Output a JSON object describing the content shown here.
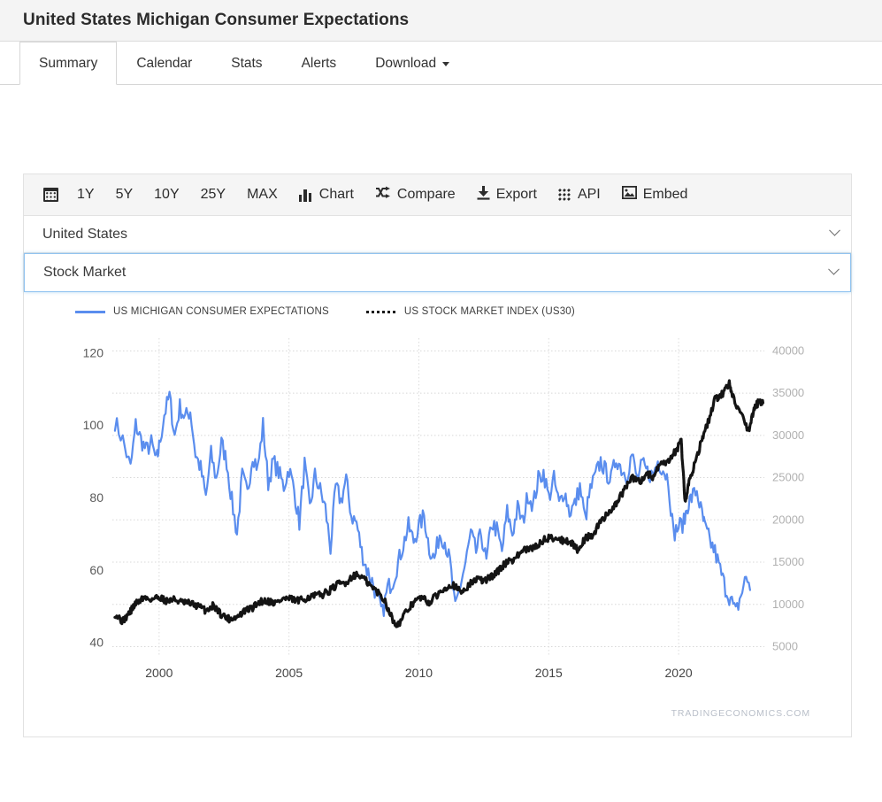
{
  "header": {
    "title": "United States Michigan Consumer Expectations"
  },
  "tabs": [
    {
      "label": "Summary",
      "active": true
    },
    {
      "label": "Calendar",
      "active": false
    },
    {
      "label": "Stats",
      "active": false
    },
    {
      "label": "Alerts",
      "active": false
    },
    {
      "label": "Download",
      "active": false,
      "has_caret": true
    }
  ],
  "toolbar": {
    "calendar_icon": "calendar-icon",
    "ranges": [
      "1Y",
      "5Y",
      "10Y",
      "25Y",
      "MAX"
    ],
    "actions": [
      {
        "label": "Chart",
        "icon": "bar-chart-icon"
      },
      {
        "label": "Compare",
        "icon": "shuffle-icon"
      },
      {
        "label": "Export",
        "icon": "download-icon"
      },
      {
        "label": "API",
        "icon": "grid-dots-icon"
      },
      {
        "label": "Embed",
        "icon": "image-icon"
      }
    ]
  },
  "selects": [
    {
      "value": "United States",
      "focused": false
    },
    {
      "value": "Stock Market",
      "focused": true
    }
  ],
  "watermark": "TRADINGECONOMICS.COM",
  "colors": {
    "series_blue": "#5a8dee",
    "series_black": "#141414",
    "panel_border": "#e2e2e2",
    "header_bg": "#f4f4f4",
    "focus_border": "#90c3f0"
  },
  "chart_data": {
    "type": "line",
    "title": "",
    "xlabel": "",
    "grid": true,
    "legend_position": "top-left",
    "x_ticks": [
      "2000",
      "2005",
      "2010",
      "2015",
      "2020"
    ],
    "xlim": [
      1998.2,
      2023.3
    ],
    "left_axis": {
      "label": "US Michigan Consumer Expectations",
      "ticks": [
        40,
        60,
        80,
        100,
        120
      ],
      "ylim": [
        36,
        124
      ]
    },
    "right_axis": {
      "label": "US Stock Market Index (US30)",
      "ticks": [
        5000,
        10000,
        15000,
        20000,
        25000,
        30000,
        35000,
        40000
      ],
      "ylim": [
        3800,
        41500
      ]
    },
    "series": [
      {
        "name": "US MICHIGAN CONSUMER EXPECTATIONS",
        "axis": "left",
        "color": "#5a8dee",
        "style": "solid",
        "x": [
          1998.3,
          1998.6,
          1998.9,
          1999.1,
          1999.3,
          1999.5,
          1999.7,
          1999.9,
          2000.0,
          2000.2,
          2000.4,
          2000.6,
          2000.8,
          2001.0,
          2001.2,
          2001.4,
          2001.6,
          2001.8,
          2002.0,
          2002.2,
          2002.4,
          2002.6,
          2002.8,
          2003.0,
          2003.2,
          2003.4,
          2003.6,
          2003.8,
          2004.0,
          2004.2,
          2004.4,
          2004.6,
          2004.8,
          2005.0,
          2005.2,
          2005.4,
          2005.6,
          2005.8,
          2006.0,
          2006.2,
          2006.4,
          2006.6,
          2006.8,
          2007.0,
          2007.2,
          2007.4,
          2007.6,
          2007.8,
          2008.0,
          2008.2,
          2008.4,
          2008.6,
          2008.8,
          2009.0,
          2009.2,
          2009.4,
          2009.6,
          2009.8,
          2010.0,
          2010.2,
          2010.4,
          2010.6,
          2010.8,
          2011.0,
          2011.2,
          2011.4,
          2011.6,
          2011.8,
          2012.0,
          2012.2,
          2012.4,
          2012.6,
          2012.8,
          2013.0,
          2013.2,
          2013.4,
          2013.6,
          2013.8,
          2014.0,
          2014.2,
          2014.4,
          2014.6,
          2014.8,
          2015.0,
          2015.2,
          2015.4,
          2015.6,
          2015.8,
          2016.0,
          2016.2,
          2016.4,
          2016.6,
          2016.8,
          2017.0,
          2017.2,
          2017.4,
          2017.6,
          2017.8,
          2018.0,
          2018.2,
          2018.4,
          2018.6,
          2018.8,
          2019.0,
          2019.2,
          2019.4,
          2019.6,
          2019.8,
          2020.0,
          2020.2,
          2020.35,
          2020.5,
          2020.7,
          2020.9,
          2021.0,
          2021.2,
          2021.4,
          2021.6,
          2021.8,
          2022.0,
          2022.2,
          2022.4,
          2022.6,
          2022.8,
          2023.0,
          2023.2
        ],
        "y": [
          101,
          96,
          88,
          100,
          96,
          93,
          95,
          90,
          94,
          103,
          108,
          97,
          105,
          102,
          104,
          92,
          88,
          80,
          92,
          85,
          95,
          90,
          79,
          70,
          86,
          81,
          92,
          88,
          100,
          84,
          90,
          87,
          83,
          88,
          82,
          73,
          89,
          77,
          86,
          82,
          77,
          66,
          83,
          79,
          85,
          75,
          73,
          65,
          60,
          57,
          52,
          48,
          55,
          57,
          62,
          67,
          72,
          68,
          72,
          75,
          66,
          63,
          70,
          68,
          62,
          49,
          56,
          62,
          70,
          65,
          70,
          62,
          73,
          71,
          65,
          76,
          70,
          77,
          73,
          81,
          78,
          85,
          87,
          80,
          85,
          78,
          82,
          76,
          78,
          83,
          74,
          82,
          86,
          90,
          87,
          85,
          91,
          88,
          86,
          92,
          85,
          89,
          87,
          86,
          90,
          88,
          85,
          70,
          72,
          73,
          78,
          80,
          82,
          75,
          72,
          68,
          65,
          60,
          55,
          52,
          48,
          53,
          58,
          55
        ]
      },
      {
        "name": "US STOCK MARKET INDEX (US30)",
        "axis": "right",
        "color": "#141414",
        "style": "dotted",
        "x": [
          1998.3,
          1998.6,
          1998.9,
          1999.1,
          1999.4,
          1999.7,
          2000.0,
          2000.3,
          2000.6,
          2000.9,
          2001.2,
          2001.5,
          2001.8,
          2002.1,
          2002.4,
          2002.7,
          2003.0,
          2003.3,
          2003.6,
          2003.9,
          2004.2,
          2004.5,
          2004.8,
          2005.1,
          2005.4,
          2005.7,
          2006.0,
          2006.3,
          2006.6,
          2006.9,
          2007.2,
          2007.5,
          2007.8,
          2008.1,
          2008.4,
          2008.7,
          2009.0,
          2009.2,
          2009.5,
          2009.8,
          2010.1,
          2010.4,
          2010.7,
          2011.0,
          2011.3,
          2011.6,
          2011.9,
          2012.2,
          2012.5,
          2012.8,
          2013.1,
          2013.4,
          2013.7,
          2014.0,
          2014.3,
          2014.6,
          2014.9,
          2015.2,
          2015.5,
          2015.8,
          2016.1,
          2016.4,
          2016.7,
          2017.0,
          2017.3,
          2017.6,
          2017.9,
          2018.2,
          2018.5,
          2018.8,
          2019.0,
          2019.3,
          2019.6,
          2019.9,
          2020.1,
          2020.25,
          2020.4,
          2020.6,
          2020.9,
          2021.1,
          2021.4,
          2021.7,
          2021.95,
          2022.1,
          2022.4,
          2022.7,
          2022.9,
          2023.1,
          2023.25
        ],
        "y": [
          8900,
          8000,
          9200,
          10100,
          10800,
          10600,
          10900,
          10400,
          10600,
          10200,
          10100,
          9800,
          9300,
          9900,
          8800,
          8300,
          8500,
          9200,
          9600,
          10400,
          10400,
          10200,
          10700,
          10600,
          10400,
          10800,
          11000,
          11200,
          11700,
          12400,
          12600,
          13500,
          13300,
          12300,
          11500,
          10400,
          8100,
          7600,
          9000,
          10300,
          10800,
          10200,
          11100,
          12000,
          12400,
          11400,
          12200,
          13000,
          12800,
          13300,
          14100,
          15100,
          15400,
          16400,
          16500,
          17100,
          17800,
          17900,
          17600,
          17500,
          16500,
          17800,
          18200,
          19800,
          20900,
          21900,
          23500,
          25000,
          24500,
          25500,
          25000,
          26500,
          26800,
          28200,
          29300,
          22000,
          24500,
          26500,
          29500,
          31200,
          34200,
          35000,
          36200,
          34500,
          32500,
          30500,
          33200,
          34000,
          33800
        ]
      }
    ]
  }
}
